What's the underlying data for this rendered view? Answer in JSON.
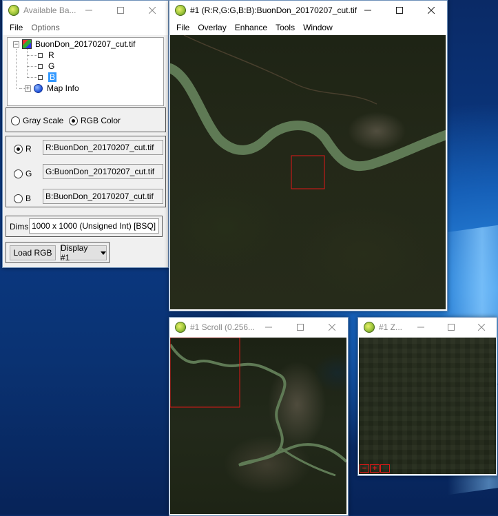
{
  "bands_window": {
    "title": "Available Ba...",
    "menu": [
      "File",
      "Options"
    ],
    "tree": {
      "file": "BuonDon_20170207_cut.tif",
      "bands": [
        "R",
        "G",
        "B"
      ],
      "selected_band": "B",
      "map_info": "Map Info"
    },
    "mode": {
      "gray": "Gray Scale",
      "rgb": "RGB Color",
      "selected": "RGB Color"
    },
    "channels": [
      {
        "label": "R",
        "value": "R:BuonDon_20170207_cut.tif",
        "selected": true
      },
      {
        "label": "G",
        "value": "G:BuonDon_20170207_cut.tif",
        "selected": false
      },
      {
        "label": "B",
        "value": "B:BuonDon_20170207_cut.tif",
        "selected": false
      }
    ],
    "dims_label": "Dims",
    "dims_value": "1000 x 1000 (Unsigned Int) [BSQ]",
    "load_button": "Load RGB",
    "display_button": "Display #1"
  },
  "main_window": {
    "title": "#1 (R:R,G:G,B:B):BuonDon_20170207_cut.tif",
    "menu": [
      "File",
      "Overlay",
      "Enhance",
      "Tools",
      "Window"
    ]
  },
  "scroll_window": {
    "title": "#1 Scroll (0.256..."
  },
  "zoom_window": {
    "title": "#1 Z...",
    "buttons": [
      "−",
      "+",
      ""
    ]
  },
  "colors": {
    "river": "#5f7a55",
    "selection_box": "#e01818",
    "highlight": "#3399ff"
  }
}
